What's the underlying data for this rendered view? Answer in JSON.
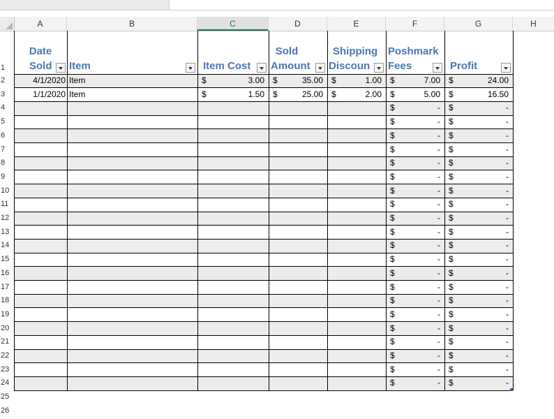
{
  "columns": [
    "A",
    "B",
    "C",
    "D",
    "E",
    "F",
    "G",
    "H"
  ],
  "row_numbers": [
    "1",
    "2",
    "3",
    "4",
    "5",
    "6",
    "7",
    "8",
    "9",
    "10",
    "11",
    "12",
    "13",
    "14",
    "15",
    "16",
    "17",
    "18",
    "19",
    "20",
    "21",
    "22",
    "23",
    "24",
    "25",
    "26"
  ],
  "table_headers": {
    "a": {
      "line1": "Date",
      "line2": "Sold"
    },
    "b": {
      "line1": "",
      "line2": "Item"
    },
    "c": {
      "line1": "",
      "line2": "Item Cost"
    },
    "d": {
      "line1": "Sold",
      "line2": "Amount"
    },
    "e": {
      "line1": "Shipping",
      "line2": "Discoun"
    },
    "f": {
      "line1": "Poshmark",
      "line2": "Fees"
    },
    "g": {
      "line1": "",
      "line2": "Profit"
    }
  },
  "rows": [
    {
      "date": "4/1/2020",
      "item": "Item",
      "cost": "3.00",
      "sold": "35.00",
      "ship": "1.00",
      "fees": "7.00",
      "profit": "24.00"
    },
    {
      "date": "1/1/2020",
      "item": "Item",
      "cost": "1.50",
      "sold": "25.00",
      "ship": "2.00",
      "fees": "5.00",
      "profit": "16.50"
    }
  ],
  "currency_symbol": "$",
  "empty_value": "-",
  "empty_row_count": 21,
  "colors": {
    "header_text": "#4a76b8",
    "band": "#ececec",
    "selected_col": "#217346"
  }
}
